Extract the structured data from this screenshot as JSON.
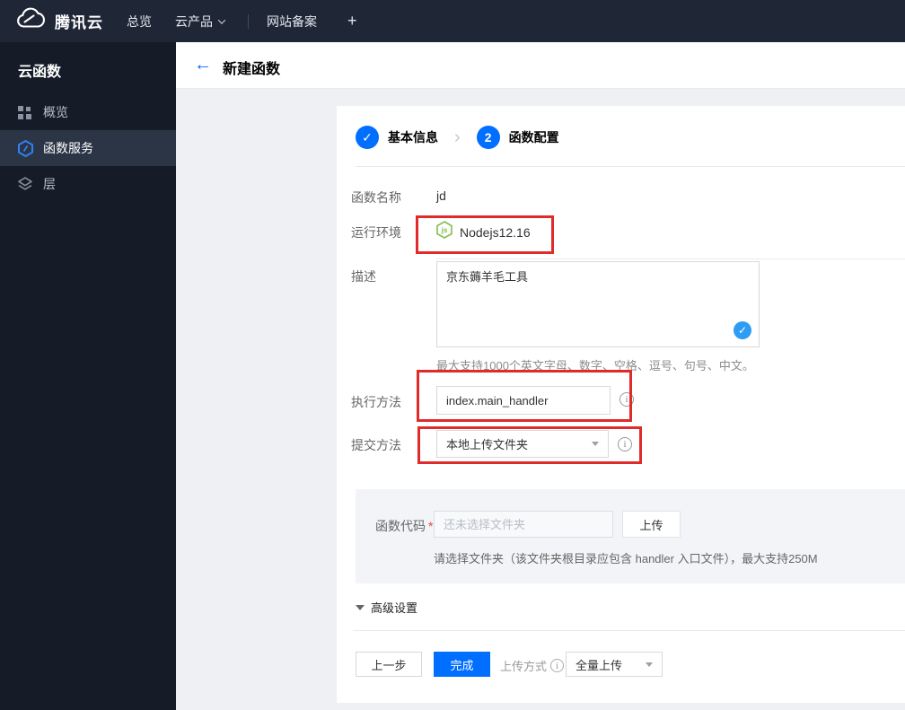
{
  "topbar": {
    "brand": "腾讯云",
    "nav": [
      {
        "label": "总览"
      },
      {
        "label": "云产品"
      },
      {
        "label": "网站备案"
      },
      {
        "label": "+"
      }
    ]
  },
  "sidebar": {
    "title": "云函数",
    "items": [
      {
        "label": "概览",
        "icon": "grid-icon",
        "active": false
      },
      {
        "label": "函数服务",
        "icon": "function-hexagon-icon",
        "active": true
      },
      {
        "label": "层",
        "icon": "layers-icon",
        "active": false
      }
    ]
  },
  "header": {
    "back_glyph": "←",
    "title": "新建函数"
  },
  "stepper": {
    "steps": [
      {
        "label": "基本信息",
        "state": "done",
        "glyph": "✓"
      },
      {
        "label": "函数配置",
        "state": "current",
        "number": "2"
      }
    ],
    "chevron": "›"
  },
  "form": {
    "function_name": {
      "label": "函数名称",
      "value": "jd"
    },
    "runtime": {
      "label": "运行环境",
      "value": "Nodejs12.16",
      "icon": "nodejs-hexagon-icon"
    },
    "description": {
      "label": "描述",
      "value": "京东薅羊毛工具",
      "check_glyph": "✓",
      "helper": "最大支持1000个英文字母、数字、空格、逗号、句号、中文。"
    },
    "handler": {
      "label": "执行方法",
      "value": "index.main_handler",
      "info_glyph": "i"
    },
    "submit_method": {
      "label": "提交方法",
      "value": "本地上传文件夹",
      "info_glyph": "i"
    },
    "function_code": {
      "label": "函数代码",
      "required_mark": "*",
      "placeholder": "还未选择文件夹",
      "upload_button": "上传",
      "helper": "请选择文件夹（该文件夹根目录应包含 handler 入口文件），最大支持250M"
    },
    "advanced": {
      "label": "高级设置"
    }
  },
  "footer": {
    "prev_button": "上一步",
    "finish_button": "完成",
    "upload_mode_label": "上传方式",
    "upload_mode_info_glyph": "i",
    "upload_mode_value": "全量上传"
  },
  "colors": {
    "accent_blue": "#006eff",
    "annotation_red": "#e02b2b",
    "nodejs_green": "#7fbf4d",
    "desc_check_blue": "#2d9cf5",
    "topbar_bg": "#1f2636",
    "sidebar_bg": "#161c27",
    "sidebar_active_bg": "#2c3545"
  }
}
